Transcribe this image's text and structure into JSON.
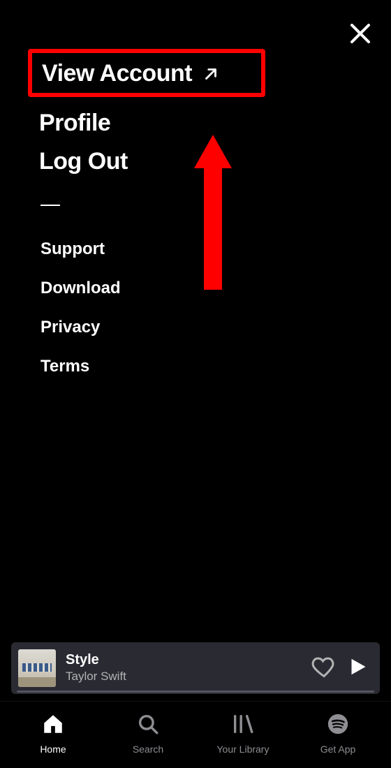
{
  "menu": {
    "primary": [
      {
        "label": "View Account",
        "external": true,
        "highlighted": true
      },
      {
        "label": "Profile",
        "external": false,
        "highlighted": false
      },
      {
        "label": "Log Out",
        "external": false,
        "highlighted": false
      }
    ],
    "secondary": [
      {
        "label": "Support"
      },
      {
        "label": "Download"
      },
      {
        "label": "Privacy"
      },
      {
        "label": "Terms"
      }
    ]
  },
  "annotation": {
    "highlight_color": "#ff0000",
    "arrow_points_to": "View Account"
  },
  "now_playing": {
    "track": "Style",
    "artist": "Taylor Swift",
    "liked": false,
    "playing": false
  },
  "nav": {
    "items": [
      {
        "id": "home",
        "label": "Home",
        "active": true
      },
      {
        "id": "search",
        "label": "Search",
        "active": false
      },
      {
        "id": "library",
        "label": "Your Library",
        "active": false
      },
      {
        "id": "getapp",
        "label": "Get App",
        "active": false
      }
    ]
  }
}
